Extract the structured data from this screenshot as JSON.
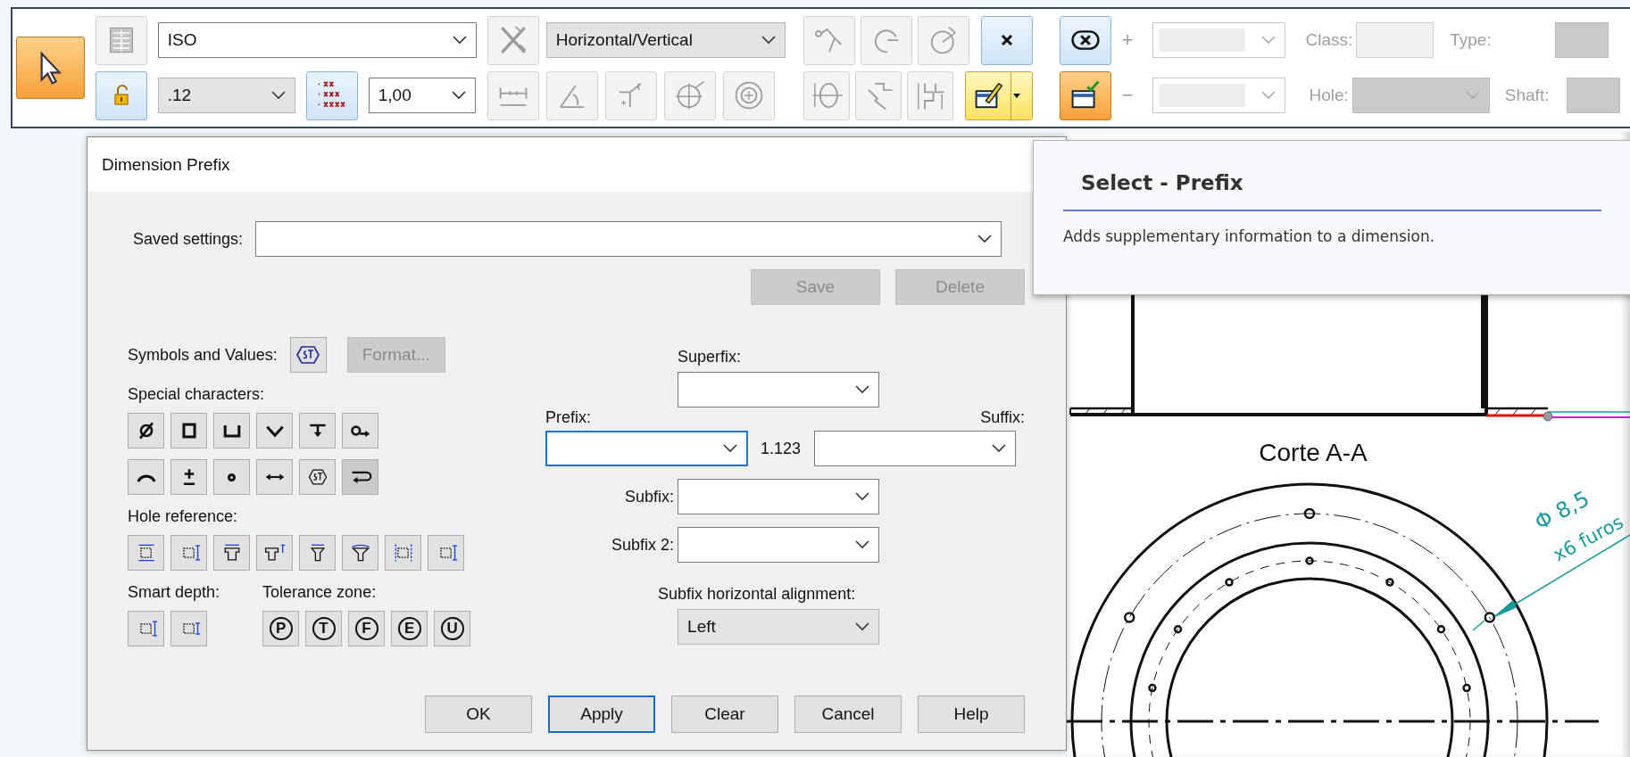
{
  "toolbar": {
    "select_button": {
      "selected": true
    },
    "style_button": {
      "disabled": true
    },
    "lock_button": {
      "pressed": true
    },
    "standard_dropdown": {
      "value": "ISO"
    },
    "precision_dropdown": {
      "value": ".12"
    },
    "precision_button": {
      "pressed": true
    },
    "scale_dropdown": {
      "value": "1,00"
    },
    "orientation_button": {
      "disabled": true
    },
    "orientation_dropdown": {
      "value": "Horizontal/Vertical"
    },
    "dimension_buttons": [
      {
        "disabled": true
      },
      {
        "disabled": true
      },
      {
        "disabled": true
      },
      {
        "disabled": true
      },
      {
        "disabled": true
      }
    ],
    "upper_buttons": [
      {
        "disabled": true
      },
      {
        "disabled": true
      },
      {
        "disabled": true
      }
    ],
    "lower_buttons": [
      {
        "disabled": true
      },
      {
        "disabled": true
      },
      {
        "disabled": true
      }
    ],
    "remove_button": {
      "pressed": true
    },
    "prefix_button": {
      "highlighted": true
    },
    "circled_x_button": {
      "pressed": true
    },
    "prefix_check_button": {
      "checked": true
    },
    "plus_sign": "+",
    "minus_sign": "−",
    "tolerance_fit": {
      "disabled": true,
      "class_label": "Class:",
      "type_label": "Type:",
      "hole_label": "Hole:",
      "shaft_label": "Shaft:"
    }
  },
  "dialog": {
    "title": "Dimension Prefix",
    "saved_settings_label": "Saved settings:",
    "save_button": {
      "label": "Save",
      "disabled": true
    },
    "delete_button": {
      "label": "Delete",
      "disabled": true
    },
    "symbols_label": "Symbols and Values:",
    "format_button": {
      "label": "Format...",
      "disabled": true
    },
    "special_characters": {
      "label": "Special characters:",
      "buttons": [
        {
          "pressed": false
        },
        {
          "pressed": false
        },
        {
          "pressed": false
        },
        {
          "pressed": false
        },
        {
          "pressed": false
        },
        {
          "pressed": false
        },
        {
          "pressed": false
        },
        {
          "pressed": false
        },
        {
          "pressed": false
        },
        {
          "pressed": false
        },
        {
          "pressed": false
        },
        {
          "pressed": true
        }
      ]
    },
    "hole_reference": {
      "label": "Hole reference:",
      "buttons": [
        {
          "pressed": false
        },
        {
          "pressed": false
        },
        {
          "pressed": false
        },
        {
          "pressed": false
        },
        {
          "pressed": false
        },
        {
          "pressed": false
        },
        {
          "pressed": false
        },
        {
          "pressed": false
        }
      ]
    },
    "smart_depth": {
      "label": "Smart depth:",
      "buttons": [
        {
          "pressed": false
        },
        {
          "pressed": false
        }
      ]
    },
    "tolerance_zone": {
      "label": "Tolerance zone:",
      "buttons": [
        {
          "label": "P",
          "pressed": false
        },
        {
          "label": "T",
          "pressed": false
        },
        {
          "label": "F",
          "pressed": false
        },
        {
          "label": "E",
          "pressed": false
        },
        {
          "label": "U",
          "pressed": false
        }
      ]
    },
    "superfix": {
      "label": "Superfix:",
      "focused": false
    },
    "prefix": {
      "label": "Prefix:",
      "focused": true
    },
    "sample_value": "1.123",
    "suffix": {
      "label": "Suffix:",
      "focused": false
    },
    "subfix": {
      "label": "Subfix:",
      "focused": false
    },
    "subfix_2": {
      "label": "Subfix 2:",
      "focused": false
    },
    "alignment": {
      "label": "Subfix horizontal alignment:",
      "value": "Left"
    },
    "footer_buttons": [
      {
        "label": "OK",
        "default": false
      },
      {
        "label": "Apply",
        "default": true
      },
      {
        "label": "Clear",
        "default": false
      },
      {
        "label": "Cancel",
        "default": false
      },
      {
        "label": "Help",
        "default": false
      }
    ]
  },
  "tooltip": {
    "title": "Select - Prefix",
    "text": "Adds supplementary information to a dimension."
  },
  "drawing": {
    "view_title": "Corte A-A",
    "hole_dimension": "Φ 8,5",
    "hole_note": "x6 furos"
  }
}
